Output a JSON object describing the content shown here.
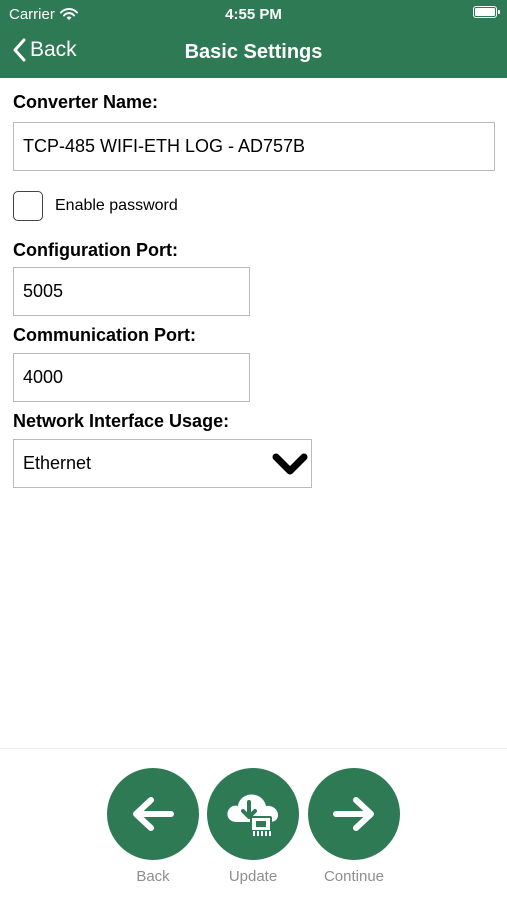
{
  "status_bar": {
    "carrier": "Carrier",
    "time": "4:55 PM"
  },
  "nav": {
    "back_label": "Back",
    "title": "Basic Settings"
  },
  "form": {
    "converter_name_label": "Converter Name:",
    "converter_name_value": "TCP-485 WIFI-ETH LOG - AD757B",
    "enable_password_label": "Enable password",
    "enable_password_checked": false,
    "config_port_label": "Configuration Port:",
    "config_port_value": "5005",
    "comm_port_label": "Communication Port:",
    "comm_port_value": "4000",
    "network_interface_label": "Network Interface Usage:",
    "network_interface_value": "Ethernet"
  },
  "actions": {
    "back_label": "Back",
    "update_label": "Update",
    "continue_label": "Continue"
  },
  "colors": {
    "brand_green": "#2e7a55",
    "action_label_gray": "#8e8e8e"
  },
  "icons": [
    "wifi-icon",
    "battery-icon",
    "chevron-left-icon",
    "chevron-down-icon",
    "arrow-left-icon",
    "cloud-download-chip-icon",
    "arrow-right-icon"
  ]
}
